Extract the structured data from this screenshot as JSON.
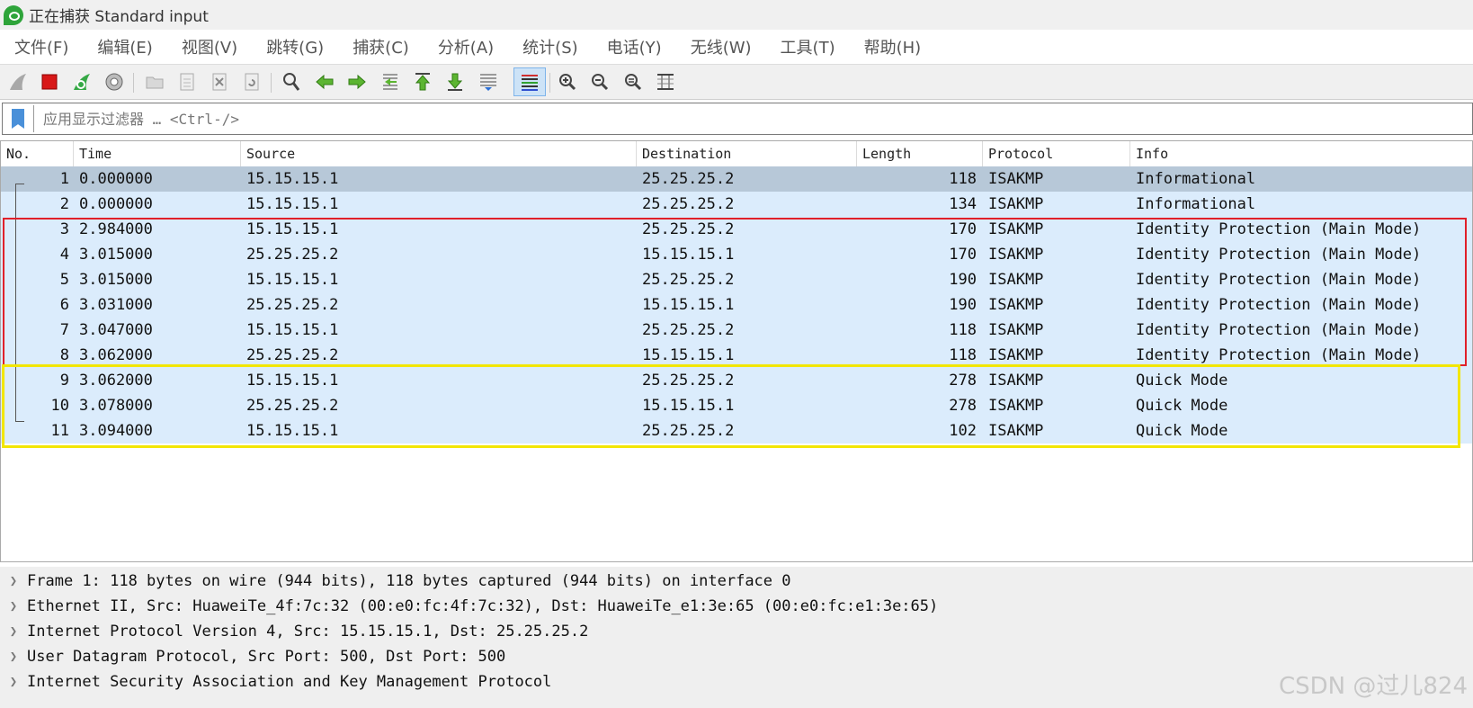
{
  "window": {
    "title": "正在捕获 Standard input"
  },
  "menu": [
    "文件(F)",
    "编辑(E)",
    "视图(V)",
    "跳转(G)",
    "捕获(C)",
    "分析(A)",
    "统计(S)",
    "电话(Y)",
    "无线(W)",
    "工具(T)",
    "帮助(H)"
  ],
  "toolbar": {
    "icons": [
      "shark-fin-start-icon",
      "stop-capture-icon",
      "restart-capture-icon",
      "capture-options-icon",
      "open-file-icon",
      "save-file-icon",
      "close-file-icon",
      "reload-file-icon",
      "find-packet-icon",
      "go-back-icon",
      "go-forward-icon",
      "go-to-packet-icon",
      "first-packet-icon",
      "last-packet-icon",
      "auto-scroll-icon",
      "colorize-icon",
      "zoom-in-icon",
      "zoom-out-icon",
      "normal-size-icon",
      "resize-columns-icon"
    ]
  },
  "filter": {
    "placeholder": "应用显示过滤器 … <Ctrl-/>"
  },
  "columns": [
    "No.",
    "Time",
    "Source",
    "Destination",
    "Length",
    "Protocol",
    "Info"
  ],
  "packets": [
    {
      "no": "1",
      "time": "0.000000",
      "src": "15.15.15.1",
      "dst": "25.25.25.2",
      "len": "118",
      "proto": "ISAKMP",
      "info": "Informational"
    },
    {
      "no": "2",
      "time": "0.000000",
      "src": "15.15.15.1",
      "dst": "25.25.25.2",
      "len": "134",
      "proto": "ISAKMP",
      "info": "Informational"
    },
    {
      "no": "3",
      "time": "2.984000",
      "src": "15.15.15.1",
      "dst": "25.25.25.2",
      "len": "170",
      "proto": "ISAKMP",
      "info": "Identity Protection (Main Mode)"
    },
    {
      "no": "4",
      "time": "3.015000",
      "src": "25.25.25.2",
      "dst": "15.15.15.1",
      "len": "170",
      "proto": "ISAKMP",
      "info": "Identity Protection (Main Mode)"
    },
    {
      "no": "5",
      "time": "3.015000",
      "src": "15.15.15.1",
      "dst": "25.25.25.2",
      "len": "190",
      "proto": "ISAKMP",
      "info": "Identity Protection (Main Mode)"
    },
    {
      "no": "6",
      "time": "3.031000",
      "src": "25.25.25.2",
      "dst": "15.15.15.1",
      "len": "190",
      "proto": "ISAKMP",
      "info": "Identity Protection (Main Mode)"
    },
    {
      "no": "7",
      "time": "3.047000",
      "src": "15.15.15.1",
      "dst": "25.25.25.2",
      "len": "118",
      "proto": "ISAKMP",
      "info": "Identity Protection (Main Mode)"
    },
    {
      "no": "8",
      "time": "3.062000",
      "src": "25.25.25.2",
      "dst": "15.15.15.1",
      "len": "118",
      "proto": "ISAKMP",
      "info": "Identity Protection (Main Mode)"
    },
    {
      "no": "9",
      "time": "3.062000",
      "src": "15.15.15.1",
      "dst": "25.25.25.2",
      "len": "278",
      "proto": "ISAKMP",
      "info": "Quick Mode"
    },
    {
      "no": "10",
      "time": "3.078000",
      "src": "25.25.25.2",
      "dst": "15.15.15.1",
      "len": "278",
      "proto": "ISAKMP",
      "info": "Quick Mode"
    },
    {
      "no": "11",
      "time": "3.094000",
      "src": "15.15.15.1",
      "dst": "25.25.25.2",
      "len": "102",
      "proto": "ISAKMP",
      "info": "Quick Mode"
    }
  ],
  "selected_packet": "1",
  "details": [
    "Frame 1: 118 bytes on wire (944 bits), 118 bytes captured (944 bits) on interface 0",
    "Ethernet II, Src: HuaweiTe_4f:7c:32 (00:e0:fc:4f:7c:32), Dst: HuaweiTe_e1:3e:65 (00:e0:fc:e1:3e:65)",
    "Internet Protocol Version 4, Src: 15.15.15.1, Dst: 25.25.25.2",
    "User Datagram Protocol, Src Port: 500, Dst Port: 500",
    "Internet Security Association and Key Management Protocol"
  ],
  "annotations": {
    "main_mode_box_color": "#e0202a",
    "quick_mode_box_color": "#f2e600"
  },
  "colors": {
    "row_bg": "#dbecfc",
    "selected_bg": "#b7c8d8"
  },
  "watermark": "CSDN @过儿824"
}
